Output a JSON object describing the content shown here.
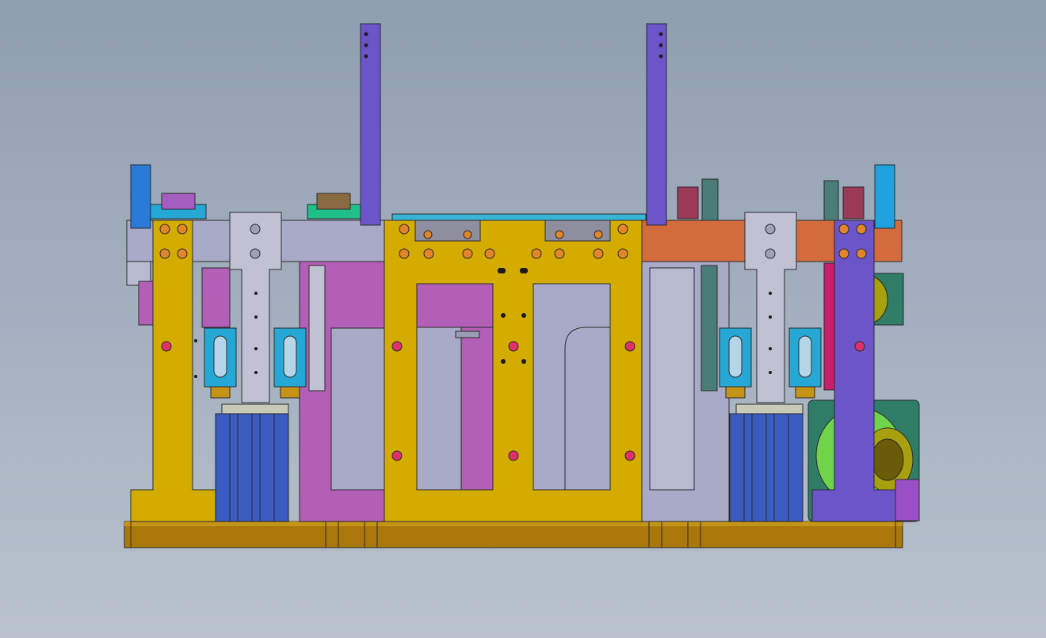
{
  "viewport": {
    "background_top": "#8f9eb0",
    "background_bottom": "#b9c2ce"
  },
  "colors": {
    "base": "#a9770a",
    "yellow": "#d4ac00",
    "magenta": "#b35fb7",
    "lavender_gray": "#a8aac8",
    "purple": "#6b55c9",
    "orange": "#d36b3c",
    "cyan": "#26a8d6",
    "blue": "#3a5bc0",
    "green": "#6fd44a",
    "teal": "#2f7d66",
    "steel": "#c0c2d4",
    "outline": "#2a2a2a"
  },
  "components": [
    "base-plate",
    "back-frame",
    "orange-crossbar",
    "yellow-center-plate",
    "yellow-left-upright",
    "purple-right-upright",
    "purple-lift-arm-left",
    "purple-lift-arm-right",
    "blue-cylinder-left",
    "blue-cylinder-right",
    "cyan-clamp-blocks",
    "green-motor-housing",
    "gray-slide-brackets",
    "blue-clamp-handles"
  ]
}
